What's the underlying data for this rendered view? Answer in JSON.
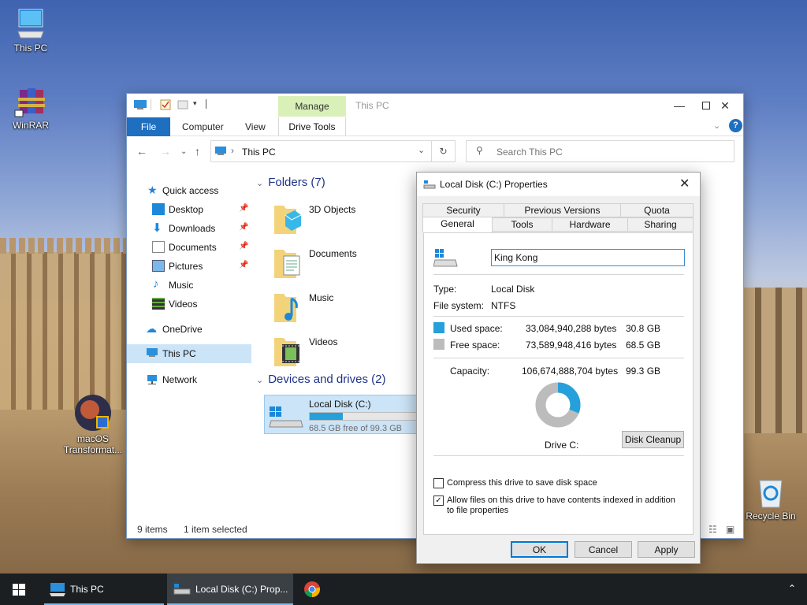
{
  "desktop": {
    "icons": [
      {
        "label": "This PC",
        "icon": "monitor-icon"
      },
      {
        "label": "WinRAR",
        "icon": "winrar-books-icon"
      },
      {
        "label": "macOS Transformat...",
        "icon": "macos-avatar-icon"
      },
      {
        "label": "Recycle Bin",
        "icon": "recycle-bin-icon"
      }
    ]
  },
  "explorer": {
    "title": "This PC",
    "contextual_tab": "Manage",
    "ribbon_tabs": {
      "file": "File",
      "computer": "Computer",
      "view": "View",
      "drive_tools": "Drive Tools"
    },
    "address": "This PC",
    "search_placeholder": "Search This PC",
    "nav": {
      "quick_access": "Quick access",
      "desktop": "Desktop",
      "downloads": "Downloads",
      "documents": "Documents",
      "pictures": "Pictures",
      "music": "Music",
      "videos": "Videos",
      "onedrive": "OneDrive",
      "this_pc": "This PC",
      "network": "Network"
    },
    "folders_header": "Folders (7)",
    "folders": [
      "3D Objects",
      "Documents",
      "Music",
      "Videos"
    ],
    "devices_header": "Devices and drives (2)",
    "drive": {
      "name": "Local Disk (C:)",
      "free_text": "68.5 GB free of 99.3 GB",
      "used_fraction": 0.31
    },
    "status": {
      "items": "9 items",
      "selected": "1 item selected"
    }
  },
  "dialog": {
    "title": "Local Disk (C:) Properties",
    "tabs_top": [
      "Security",
      "Previous Versions",
      "Quota"
    ],
    "tabs_bottom": [
      "General",
      "Tools",
      "Hardware",
      "Sharing"
    ],
    "active_tab": "General",
    "volume_label": "King Kong",
    "type_label": "Type:",
    "type_value": "Local Disk",
    "fs_label": "File system:",
    "fs_value": "NTFS",
    "used_label": "Used space:",
    "used_bytes": "33,084,940,288 bytes",
    "used_gb": "30.8 GB",
    "free_label": "Free space:",
    "free_bytes": "73,589,948,416 bytes",
    "free_gb": "68.5 GB",
    "capacity_label": "Capacity:",
    "capacity_bytes": "106,674,888,704 bytes",
    "capacity_gb": "99.3 GB",
    "drive_caption": "Drive C:",
    "disk_cleanup": "Disk Cleanup",
    "compress_label": "Compress this drive to save disk space",
    "compress_checked": false,
    "index_label": "Allow files on this drive to have contents indexed in addition to file properties",
    "index_checked": true,
    "used_fraction": 0.31,
    "ok": "OK",
    "cancel": "Cancel",
    "apply": "Apply",
    "colors": {
      "used": "#26a0da",
      "free": "#bcbcbc"
    }
  },
  "taskbar": {
    "this_pc": "This PC",
    "local_disk": "Local Disk (C:) Prop..."
  }
}
